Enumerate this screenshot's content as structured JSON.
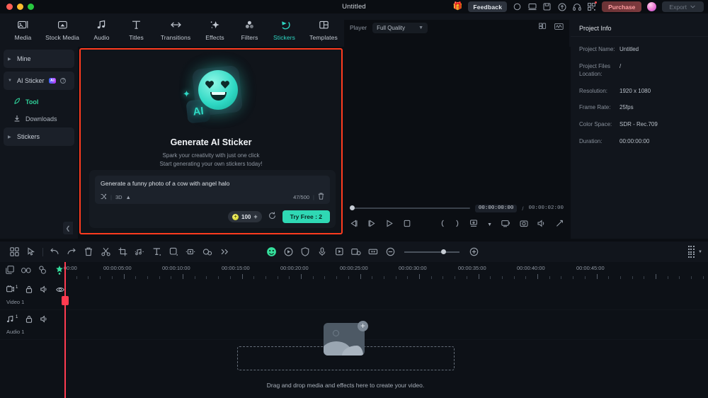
{
  "titlebar": {
    "document_title": "Untitled",
    "gift_icon": "gift-icon",
    "feedback_label": "Feedback",
    "purchase_label": "Purchase",
    "export_label": "Export",
    "icons": [
      "circle-icon",
      "screen-icon",
      "save-icon",
      "cloud-upload-icon",
      "headphone-icon",
      "qr-code-icon"
    ]
  },
  "nav": {
    "items": [
      {
        "label": "Media",
        "icon": "media-icon",
        "active": false
      },
      {
        "label": "Stock Media",
        "icon": "stock-media-icon",
        "active": false
      },
      {
        "label": "Audio",
        "icon": "audio-note-icon",
        "active": false
      },
      {
        "label": "Titles",
        "icon": "titles-text-icon",
        "active": false
      },
      {
        "label": "Transitions",
        "icon": "transitions-arrow-icon",
        "active": false
      },
      {
        "label": "Effects",
        "icon": "effects-sparkle-icon",
        "active": false
      },
      {
        "label": "Filters",
        "icon": "filters-circles-icon",
        "active": false
      },
      {
        "label": "Stickers",
        "icon": "stickers-icon",
        "active": true
      },
      {
        "label": "Templates",
        "icon": "templates-grid-icon",
        "active": false
      }
    ]
  },
  "sidebar": {
    "items": [
      {
        "label": "Mine",
        "type": "group",
        "icon": "caret-right-icon"
      },
      {
        "label": "AI Sticker",
        "type": "group",
        "icon": "caret-down-icon",
        "badge": "AI",
        "help": "help-icon"
      },
      {
        "label": "Tool",
        "type": "sub",
        "icon": "tool-icon",
        "active": true
      },
      {
        "label": "Downloads",
        "type": "sub",
        "icon": "download-icon",
        "active": false
      },
      {
        "label": "Stickers",
        "type": "group",
        "icon": "caret-right-icon"
      }
    ],
    "collapse_icon": "chevron-left-icon"
  },
  "ai_panel": {
    "mascot": {
      "badge_text": "AI",
      "star_icon": "sparkle-icon",
      "face_icon": "heart-eyes-smiley-icon"
    },
    "title": "Generate AI Sticker",
    "subtitle_line1": "Spark your creativity with just one click",
    "subtitle_line2": "Start generating your own stickers today!",
    "prompt": {
      "value": "Generate a funny photo of a cow with angel halo",
      "shuffle_icon": "shuffle-icon",
      "style_label": "3D",
      "style_caret": "caret-up-icon",
      "char_count": "47/500",
      "delete_icon": "trash-icon"
    },
    "actions": {
      "credit_value": "100",
      "credit_plus": "+",
      "coin_icon": "coin-icon",
      "refresh_icon": "refresh-icon",
      "try_free_label": "Try Free : 2"
    }
  },
  "player": {
    "label": "Player",
    "quality": "Full Quality",
    "quality_caret": "chevron-down-icon",
    "top_icons": [
      "snapshot-grid-icon",
      "waveform-icon"
    ],
    "timecode_current": "00:00:00:00",
    "timecode_separator": "/",
    "timecode_total": "00:00:02:00",
    "controls": [
      "prev-frame-icon",
      "next-frame-icon",
      "play-icon",
      "stop-icon",
      "mark-in-icon",
      "mark-out-icon",
      "snapshot-icon",
      "caret-down-icon",
      "crop-screen-icon",
      "camera-icon",
      "volume-icon",
      "fullscreen-icon"
    ]
  },
  "project_info": {
    "title": "Project Info",
    "rows": [
      {
        "key": "Project Name:",
        "value": "Untitled"
      },
      {
        "key": "Project Files Location:",
        "value": "/"
      },
      {
        "key": "Resolution:",
        "value": "1920 x 1080"
      },
      {
        "key": "Frame Rate:",
        "value": "25fps"
      },
      {
        "key": "Color Space:",
        "value": "SDR - Rec.709"
      },
      {
        "key": "Duration:",
        "value": "00:00:00:00"
      }
    ]
  },
  "timeline_toolbar": {
    "left_icons": [
      "grid-view-icon",
      "cursor-select-icon",
      "undo-icon",
      "redo-icon",
      "delete-icon",
      "split-scissors-icon",
      "crop-icon",
      "audio-detach-icon",
      "text-icon",
      "color-icon",
      "mask-icon",
      "speed-icon",
      "more-chevrons-icon"
    ],
    "right_icons": [
      "ai-smart-icon",
      "keyframe-icon",
      "shield-icon",
      "microphone-icon",
      "record-screen-icon",
      "green-screen-icon",
      "marker-icon"
    ],
    "zoom_out_icon": "zoom-out-icon",
    "zoom_in_icon": "zoom-in-icon",
    "grid_icon": "grid-dots-icon"
  },
  "timeline": {
    "header_icons": [
      "copy-icon",
      "link-icon",
      "snap-icon",
      "ai-timeline-icon"
    ],
    "ruler_labels": [
      "00:00",
      "00:00:05:00",
      "00:00:10:00",
      "00:00:15:00",
      "00:00:20:00",
      "00:00:25:00",
      "00:00:30:00",
      "00:00:35:00",
      "00:00:40:00",
      "00:00:45:00"
    ],
    "tracks": [
      {
        "name": "Video 1",
        "num": "1",
        "icon": "video-track-icon",
        "controls": [
          "lock-icon",
          "mute-icon",
          "eye-icon"
        ]
      },
      {
        "name": "Audio 1",
        "num": "1",
        "icon": "audio-track-icon",
        "controls": [
          "lock-icon",
          "mute-icon"
        ]
      }
    ],
    "dropzone_text": "Drag and drop media and effects here to create your video.",
    "dropzone_plus_icon": "plus-circle-icon",
    "dropzone_media_icon": "image-placeholder-icon"
  },
  "colors": {
    "accent_teal": "#2fd8c4",
    "accent_green": "#2fd29a",
    "highlight_border": "#ff3b1f",
    "playhead": "#ff3b50",
    "purchase": "#7d3a3e"
  }
}
